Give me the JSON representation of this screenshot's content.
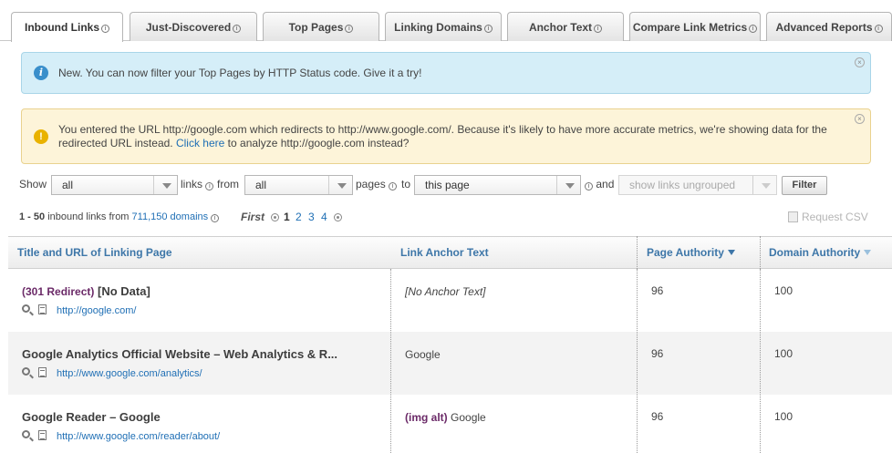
{
  "tabs": [
    {
      "label": "Inbound Links",
      "active": true
    },
    {
      "label": "Just-Discovered",
      "active": false
    },
    {
      "label": "Top Pages",
      "active": false
    },
    {
      "label": "Linking Domains",
      "active": false
    },
    {
      "label": "Anchor Text",
      "active": false
    },
    {
      "label": "Compare Link Metrics",
      "active": false
    },
    {
      "label": "Advanced Reports",
      "active": false
    }
  ],
  "alerts": {
    "info": {
      "text": "New. You can now filter your Top Pages by HTTP Status code. Give it a try!",
      "color": "#d5eef8"
    },
    "warning": {
      "text_before": "You entered the URL http://google.com which redirects to http://www.google.com/. Because it's likely to have more accurate metrics, we're showing data for the redirected URL instead.",
      "link": "Click here",
      "text_after": "to analyze http://google.com instead?",
      "color": "#fdf4d9"
    }
  },
  "filter": {
    "show_label": "Show",
    "show_value": "all",
    "links_label": "links",
    "from_label": "from",
    "from_value": "all",
    "pages_label": "pages",
    "to_label": "to",
    "to_value": "this page",
    "and_label": "and",
    "group_value": "show links ungrouped",
    "filter_button": "Filter"
  },
  "pager": {
    "range": "1 - 50",
    "text_mid": "inbound links from",
    "domains_link": "711,150 domains",
    "first_label": "First",
    "current_page": "1",
    "pages": [
      "2",
      "3",
      "4"
    ],
    "csv_label": "Request CSV"
  },
  "table": {
    "headers": {
      "title_url": "Title and URL of Linking Page",
      "anchor": "Link Anchor Text",
      "page_authority": "Page Authority",
      "domain_authority": "Domain Authority"
    },
    "rows": [
      {
        "redirect": "(301 Redirect)",
        "title": "[No Data]",
        "url": "http://google.com/",
        "anchor_prefix": "",
        "anchor": "[No Anchor Text]",
        "page_authority": "96",
        "domain_authority": "100"
      },
      {
        "redirect": "",
        "title": "Google Analytics Official Website – Web Analytics & R...",
        "url": "http://www.google.com/analytics/",
        "anchor_prefix": "",
        "anchor": "Google",
        "page_authority": "96",
        "domain_authority": "100"
      },
      {
        "redirect": "",
        "title": "Google Reader – Google",
        "url": "http://www.google.com/reader/about/",
        "anchor_prefix": "(img alt)",
        "anchor": "Google",
        "page_authority": "96",
        "domain_authority": "100"
      }
    ]
  },
  "icons": {
    "info": "info-icon",
    "warning": "warning-icon",
    "close": "close-icon",
    "help": "help-icon",
    "magnifier": "magnifier-icon",
    "document": "document-icon"
  }
}
